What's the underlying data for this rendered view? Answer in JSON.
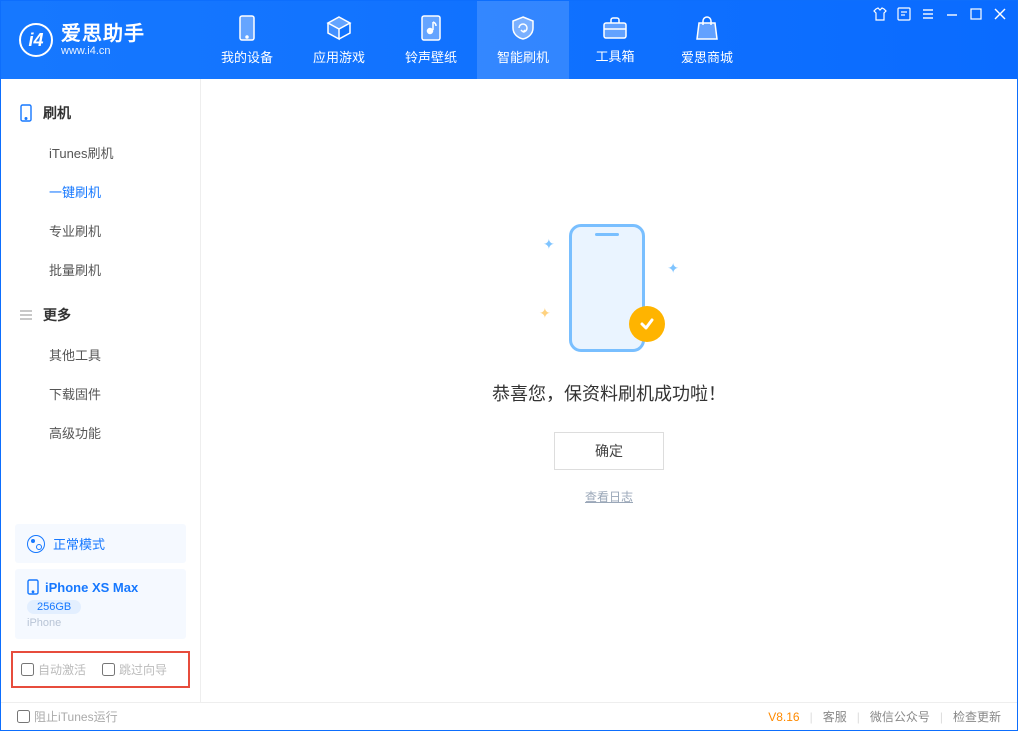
{
  "app": {
    "name": "爱思助手",
    "url": "www.i4.cn"
  },
  "tabs": {
    "device": "我的设备",
    "apps": "应用游戏",
    "ringtone": "铃声壁纸",
    "flash": "智能刷机",
    "toolbox": "工具箱",
    "store": "爱思商城"
  },
  "sidebar": {
    "flash_header": "刷机",
    "itunes": "iTunes刷机",
    "onekey": "一键刷机",
    "pro": "专业刷机",
    "batch": "批量刷机",
    "more_header": "更多",
    "other_tools": "其他工具",
    "download_fw": "下载固件",
    "advanced": "高级功能"
  },
  "mode": {
    "label": "正常模式"
  },
  "device": {
    "name": "iPhone XS Max",
    "capacity": "256GB",
    "type": "iPhone"
  },
  "checks": {
    "auto_activate": "自动激活",
    "skip_guide": "跳过向导"
  },
  "main": {
    "success": "恭喜您，保资料刷机成功啦！",
    "ok": "确定",
    "view_log": "查看日志"
  },
  "status": {
    "block_itunes": "阻止iTunes运行",
    "version": "V8.16",
    "support": "客服",
    "wechat": "微信公众号",
    "update": "检查更新"
  }
}
